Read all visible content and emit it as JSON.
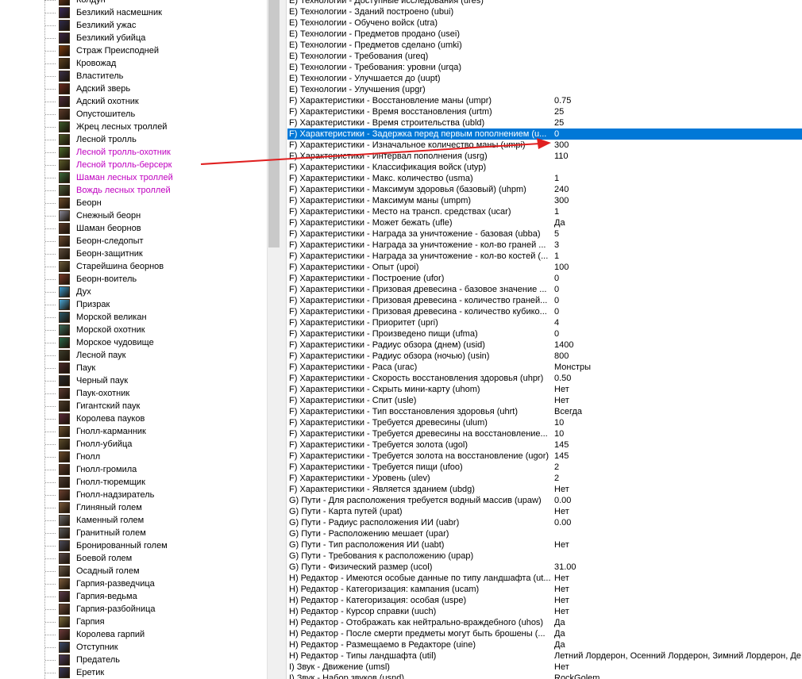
{
  "tree": {
    "items": [
      {
        "label": "Колдун",
        "color": "#6a3a20",
        "modified": false
      },
      {
        "label": "Безликий насмешник",
        "color": "#3a2a5a",
        "modified": false
      },
      {
        "label": "Безликий ужас",
        "color": "#2e2a4a",
        "modified": false
      },
      {
        "label": "Безликий убийца",
        "color": "#3a2444",
        "modified": false
      },
      {
        "label": "Страж Преисподней",
        "color": "#7a3a10",
        "modified": false
      },
      {
        "label": "Кровожад",
        "color": "#5a4020",
        "modified": false
      },
      {
        "label": "Властитель",
        "color": "#3a3048",
        "modified": false
      },
      {
        "label": "Адский зверь",
        "color": "#6a2a20",
        "modified": false
      },
      {
        "label": "Адский охотник",
        "color": "#4a2a3a",
        "modified": false
      },
      {
        "label": "Опустошитель",
        "color": "#5a3a2a",
        "modified": false
      },
      {
        "label": "Жрец лесных троллей",
        "color": "#3a5a2a",
        "modified": false
      },
      {
        "label": "Лесной тролль",
        "color": "#4a5a2a",
        "modified": false
      },
      {
        "label": "Лесной тролль-охотник",
        "color": "#4a6a2a",
        "modified": true
      },
      {
        "label": "Лесной тролль-берсерк",
        "color": "#5a5a2a",
        "modified": true
      },
      {
        "label": "Шаман лесных троллей",
        "color": "#3a6a3a",
        "modified": true
      },
      {
        "label": "Вождь лесных троллей",
        "color": "#4a5a3a",
        "modified": true
      },
      {
        "label": "Беорн",
        "color": "#6a4a2a",
        "modified": false
      },
      {
        "label": "Снежный беорн",
        "color": "#8a8a9a",
        "modified": false
      },
      {
        "label": "Шаман беорнов",
        "color": "#5a3a2a",
        "modified": false
      },
      {
        "label": "Беорн-следопыт",
        "color": "#6a4a30",
        "modified": false
      },
      {
        "label": "Беорн-защитник",
        "color": "#5a4a3a",
        "modified": false
      },
      {
        "label": "Старейшина беорнов",
        "color": "#6a5a3a",
        "modified": false
      },
      {
        "label": "Беорн-воитель",
        "color": "#7a3a2a",
        "modified": false
      },
      {
        "label": "Дух",
        "color": "#3a9ad0",
        "modified": false
      },
      {
        "label": "Призрак",
        "color": "#4aa8d8",
        "modified": false
      },
      {
        "label": "Морской великан",
        "color": "#2a5a6a",
        "modified": false
      },
      {
        "label": "Морской охотник",
        "color": "#3a6a5a",
        "modified": false
      },
      {
        "label": "Морское чудовище",
        "color": "#2a6a4a",
        "modified": false
      },
      {
        "label": "Лесной паук",
        "color": "#3a3a2a",
        "modified": false
      },
      {
        "label": "Паук",
        "color": "#4a2a2a",
        "modified": false
      },
      {
        "label": "Черный паук",
        "color": "#2a2a2a",
        "modified": false
      },
      {
        "label": "Паук-охотник",
        "color": "#5a3a30",
        "modified": false
      },
      {
        "label": "Гигантский паук",
        "color": "#4a3a2a",
        "modified": false
      },
      {
        "label": "Королева пауков",
        "color": "#5a2a3a",
        "modified": false
      },
      {
        "label": "Гнолл-карманник",
        "color": "#6a5030",
        "modified": false
      },
      {
        "label": "Гнолл-убийца",
        "color": "#5a4a2a",
        "modified": false
      },
      {
        "label": "Гнолл",
        "color": "#6a4a2a",
        "modified": false
      },
      {
        "label": "Гнолл-громила",
        "color": "#5a3a2a",
        "modified": false
      },
      {
        "label": "Гнолл-тюремщик",
        "color": "#4a3a30",
        "modified": false
      },
      {
        "label": "Гнолл-надзиратель",
        "color": "#6a4030",
        "modified": false
      },
      {
        "label": "Глиняный голем",
        "color": "#7a5a3a",
        "modified": false
      },
      {
        "label": "Каменный голем",
        "color": "#6a6a6a",
        "modified": false
      },
      {
        "label": "Гранитный голем",
        "color": "#5a5a5a",
        "modified": false
      },
      {
        "label": "Бронированный голем",
        "color": "#4a4a5a",
        "modified": false
      },
      {
        "label": "Боевой голем",
        "color": "#5a4a4a",
        "modified": false
      },
      {
        "label": "Осадный голем",
        "color": "#6a5a4a",
        "modified": false
      },
      {
        "label": "Гарпия-разведчица",
        "color": "#7a5a3a",
        "modified": false
      },
      {
        "label": "Гарпия-ведьма",
        "color": "#5a3a4a",
        "modified": false
      },
      {
        "label": "Гарпия-разбойница",
        "color": "#6a4a3a",
        "modified": false
      },
      {
        "label": "Гарпия",
        "color": "#7a6a3a",
        "modified": false
      },
      {
        "label": "Королева гарпий",
        "color": "#6a3a3a",
        "modified": false
      },
      {
        "label": "Отступник",
        "color": "#3a4a6a",
        "modified": false
      },
      {
        "label": "Предатель",
        "color": "#4a3a5a",
        "modified": false
      },
      {
        "label": "Еретик",
        "color": "#3a3a5a",
        "modified": false
      }
    ]
  },
  "grid": {
    "rows": [
      {
        "name": "E) Технологии - Доступные исследования (ures)",
        "value": ""
      },
      {
        "name": "E) Технологии - Зданий построено (ubui)",
        "value": ""
      },
      {
        "name": "E) Технологии - Обучено войск (utra)",
        "value": ""
      },
      {
        "name": "E) Технологии - Предметов продано (usei)",
        "value": ""
      },
      {
        "name": "E) Технологии - Предметов сделано (umki)",
        "value": ""
      },
      {
        "name": "E) Технологии - Требования (ureq)",
        "value": ""
      },
      {
        "name": "E) Технологии - Требования: уровни (urqa)",
        "value": ""
      },
      {
        "name": "E) Технологии - Улучшается до (uupt)",
        "value": ""
      },
      {
        "name": "E) Технологии - Улучшения (upgr)",
        "value": ""
      },
      {
        "name": "F) Характеристики - Восстановление маны (umpr)",
        "value": "0.75"
      },
      {
        "name": "F) Характеристики - Время восстановления (urtm)",
        "value": "25"
      },
      {
        "name": "F) Характеристики - Время строительства (ubld)",
        "value": "25"
      },
      {
        "name": "F) Характеристики - Задержка перед первым пополнением (u...",
        "value": "0",
        "selected": true
      },
      {
        "name": "F) Характеристики - Изначальное количество маны (umpi)",
        "value": "300"
      },
      {
        "name": "F) Характеристики - Интервал пополнения (usrg)",
        "value": "110"
      },
      {
        "name": "F) Характеристики - Классификация войск (utyp)",
        "value": ""
      },
      {
        "name": "F) Характеристики - Макс. количество (usma)",
        "value": "1"
      },
      {
        "name": "F) Характеристики - Максимум здоровья (базовый) (uhpm)",
        "value": "240"
      },
      {
        "name": "F) Характеристики - Максимум маны (umpm)",
        "value": "300"
      },
      {
        "name": "F) Характеристики - Место на трансп. средствах (ucar)",
        "value": "1"
      },
      {
        "name": "F) Характеристики - Может бежать (ufle)",
        "value": "Да"
      },
      {
        "name": "F) Характеристики - Награда за уничтожение - базовая (ubba)",
        "value": "5"
      },
      {
        "name": "F) Характеристики - Награда за уничтожение - кол-во граней ...",
        "value": "3"
      },
      {
        "name": "F) Характеристики - Награда за уничтожение - кол-во костей (...",
        "value": "1"
      },
      {
        "name": "F) Характеристики - Опыт (upoi)",
        "value": "100"
      },
      {
        "name": "F) Характеристики - Построение (ufor)",
        "value": "0"
      },
      {
        "name": "F) Характеристики - Призовая древесина - базовое значение ...",
        "value": "0"
      },
      {
        "name": "F) Характеристики - Призовая древесина - количество граней...",
        "value": "0"
      },
      {
        "name": "F) Характеристики - Призовая древесина - количество кубико...",
        "value": "0"
      },
      {
        "name": "F) Характеристики - Приоритет (upri)",
        "value": "4"
      },
      {
        "name": "F) Характеристики - Произведено пищи (ufma)",
        "value": "0"
      },
      {
        "name": "F) Характеристики - Радиус обзора (днем) (usid)",
        "value": "1400"
      },
      {
        "name": "F) Характеристики - Радиус обзора (ночью) (usin)",
        "value": "800"
      },
      {
        "name": "F) Характеристики - Раса (urac)",
        "value": "Монстры"
      },
      {
        "name": "F) Характеристики - Скорость восстановления здоровья (uhpr)",
        "value": "0.50"
      },
      {
        "name": "F) Характеристики - Скрыть мини-карту (uhom)",
        "value": "Нет"
      },
      {
        "name": "F) Характеристики - Спит (usle)",
        "value": "Нет"
      },
      {
        "name": "F) Характеристики - Тип восстановления здоровья (uhrt)",
        "value": "Всегда"
      },
      {
        "name": "F) Характеристики - Требуется древесины (ulum)",
        "value": "10"
      },
      {
        "name": "F) Характеристики - Требуется древесины на восстановление...",
        "value": "10"
      },
      {
        "name": "F) Характеристики - Требуется золота (ugol)",
        "value": "145"
      },
      {
        "name": "F) Характеристики - Требуется золота на восстановление (ugor)",
        "value": "145"
      },
      {
        "name": "F) Характеристики - Требуется пищи (ufoo)",
        "value": "2"
      },
      {
        "name": "F) Характеристики - Уровень (ulev)",
        "value": "2"
      },
      {
        "name": "F) Характеристики - Является зданием (ubdg)",
        "value": "Нет"
      },
      {
        "name": "G) Пути - Для расположения требуется водный массив (upaw)",
        "value": "0.00"
      },
      {
        "name": "G) Пути - Карта путей (upat)",
        "value": "Нет"
      },
      {
        "name": "G) Пути - Радиус расположения ИИ (uabr)",
        "value": "0.00"
      },
      {
        "name": "G) Пути - Расположению мешает (upar)",
        "value": ""
      },
      {
        "name": "G) Пути - Тип расположения ИИ (uabt)",
        "value": "Нет"
      },
      {
        "name": "G) Пути - Требования к расположению (upap)",
        "value": ""
      },
      {
        "name": "G) Пути - Физический размер (ucol)",
        "value": "31.00"
      },
      {
        "name": "H) Редактор - Имеются особые данные по типу ландшафта (ut...",
        "value": "Нет"
      },
      {
        "name": "H) Редактор - Категоризация: кампания (ucam)",
        "value": "Нет"
      },
      {
        "name": "H) Редактор - Категоризация: особая (uspe)",
        "value": "Нет"
      },
      {
        "name": "H) Редактор - Курсор справки (uuch)",
        "value": "Нет"
      },
      {
        "name": "H) Редактор - Отображать как нейтрально-враждебного (uhos)",
        "value": "Да"
      },
      {
        "name": "H) Редактор - После смерти предметы могут быть брошены (...",
        "value": "Да"
      },
      {
        "name": "H) Редактор - Размещаемо в Редакторе (uine)",
        "value": "Да"
      },
      {
        "name": "H) Редактор - Типы ландшафта (util)",
        "value": "Летний Лордерон, Осенний Лордерон, Зимний Лордерон, Де"
      },
      {
        "name": "I) Звук - Движение (umsl)",
        "value": "Нет"
      },
      {
        "name": "I) Звук - Набор звуков (usnd)",
        "value": "RockGolem"
      }
    ]
  },
  "annotation_color": "#e02020",
  "selection_color": "#0078d7",
  "modified_color": "#c000c0"
}
